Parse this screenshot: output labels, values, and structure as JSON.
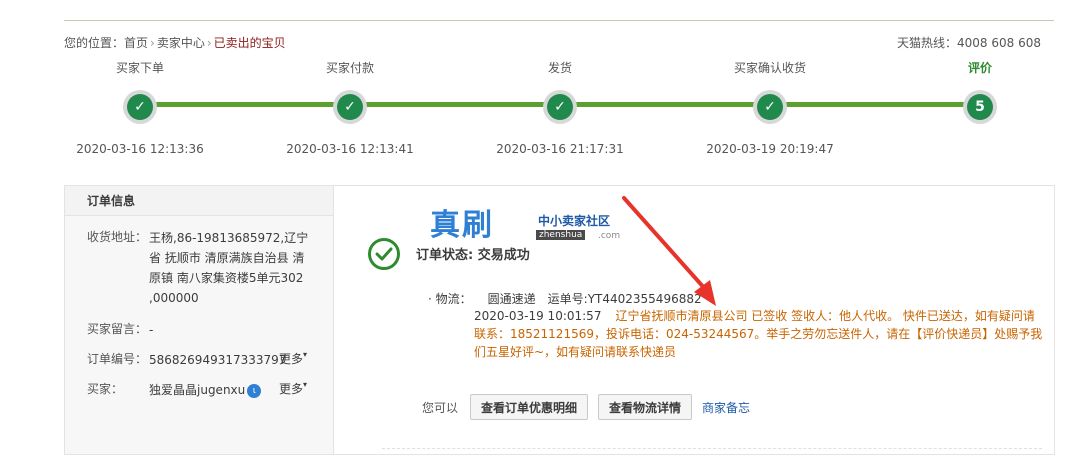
{
  "breadcrumb": {
    "prefix": "您的位置：",
    "home": "首页",
    "seller_center": "卖家中心",
    "current": "已卖出的宝贝",
    "separator": "›"
  },
  "hotline": "天猫热线：4008 608 608",
  "steps": [
    {
      "label": "买家下单",
      "time": "2020-03-16 12:13:36",
      "mark": "✓"
    },
    {
      "label": "买家付款",
      "time": "2020-03-16 12:13:41",
      "mark": "✓"
    },
    {
      "label": "发货",
      "time": "2020-03-16 21:17:31",
      "mark": "✓"
    },
    {
      "label": "买家确认收货",
      "time": "2020-03-19 20:19:47",
      "mark": "✓"
    },
    {
      "label": "评价",
      "time": "",
      "mark": "5"
    }
  ],
  "order_info": {
    "title": "订单信息",
    "address_key": "收货地址：",
    "address_value": "王杨,86-19813685972,辽宁省 抚顺市 清原满族自治县 清原镇 南八家集资楼5单元302 ,000000",
    "note_key": "买家留言：",
    "note_value": "-",
    "order_no_key": "订单编号：",
    "order_no_value": "586826949317333797",
    "buyer_key": "买家：",
    "buyer_value": "独爱晶晶jugenxu",
    "more_label": "更多",
    "more_arrow": "▾"
  },
  "watermark": {
    "big": "真刷",
    "small": "中小卖家社区",
    "url": "zhenshua",
    "com": ".com"
  },
  "status": {
    "text": "订单状态: 交易成功"
  },
  "logistics": {
    "key": "· 物流：",
    "company": "圆通速递",
    "tracking": "运单号:YT4402355496882",
    "timestamp": "2020-03-19 10:01:57",
    "message": "辽宁省抚顺市清原县公司 已签收 签收人：他人代收。 快件已送达，如有疑问请联系：18521121569，投诉电话：024-53244567。举手之劳勿忘送件人，请在【评价快递员】处赐予我们五星好评~，如有疑问请联系快递员"
  },
  "actions": {
    "label": "您可以",
    "btn_discount": "查看订单优惠明细",
    "btn_logistics": "查看物流详情",
    "link_note": "商家备忘"
  },
  "colors": {
    "progress_green": "#5aa12f",
    "dot_green": "#1f8a4c",
    "current_crumb": "#8b1a1a",
    "logistics_orange": "#c86400",
    "link_blue": "#1e5aa8",
    "arrow_red": "#e8332a"
  }
}
